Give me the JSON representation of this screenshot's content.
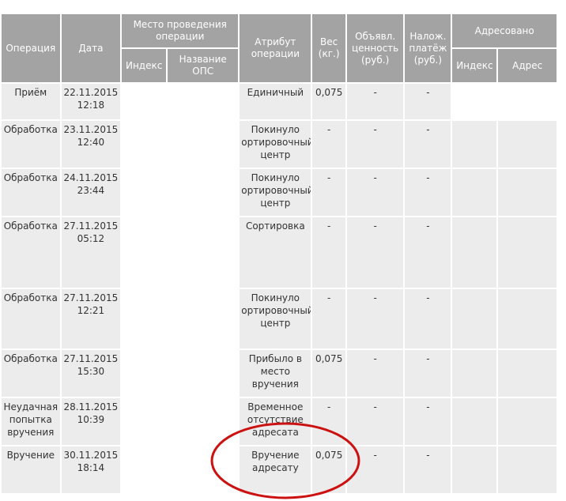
{
  "headers": {
    "operation": "Операция",
    "date": "Дата",
    "place": "Место проведения операции",
    "index": "Индекс",
    "ops_name": "Название ОПС",
    "attribute": "Атрибут операции",
    "weight": "Вес (кг.)",
    "declared_value": "Объявл. ценность (руб.)",
    "cod": "Налож. платёж (руб.)",
    "addressed": "Адресовано",
    "addr_index": "Индекс",
    "addr_address": "Адрес"
  },
  "rows": [
    {
      "operation": "Приём",
      "date": "22.11.2015 12:18",
      "attribute": "Единичный",
      "weight": "0,075",
      "declared_value": "-",
      "cod": "-"
    },
    {
      "operation": "Обработка",
      "date": "23.11.2015 12:40",
      "attribute": "Покинуло ортировочный центр",
      "weight": "-",
      "declared_value": "-",
      "cod": "-"
    },
    {
      "operation": "Обработка",
      "date": "24.11.2015 23:44",
      "attribute": "Покинуло ортировочный центр",
      "weight": "-",
      "declared_value": "-",
      "cod": "-"
    },
    {
      "operation": "Обработка",
      "date": "27.11.2015 05:12",
      "attribute": "Сортировка",
      "weight": "-",
      "declared_value": "-",
      "cod": "-"
    },
    {
      "operation": "Обработка",
      "date": "27.11.2015 12:21",
      "attribute": "Покинуло ортировочный центр",
      "weight": "-",
      "declared_value": "-",
      "cod": "-"
    },
    {
      "operation": "Обработка",
      "date": "27.11.2015 15:30",
      "attribute": "Прибыло в место вручения",
      "weight": "0,075",
      "declared_value": "-",
      "cod": "-"
    },
    {
      "operation": "Неудачная попытка вручения",
      "date": "28.11.2015 10:39",
      "attribute": "Временное отсутствие адресата",
      "weight": "-",
      "declared_value": "-",
      "cod": "-"
    },
    {
      "operation": "Вручение",
      "date": "30.11.2015 18:14",
      "attribute": "Вручение адресату",
      "weight": "0,075",
      "declared_value": "-",
      "cod": "-"
    }
  ],
  "colors": {
    "header_bg": "#a3a3a3",
    "cell_bg": "#ececec",
    "highlight_ellipse": "#cc1111"
  }
}
